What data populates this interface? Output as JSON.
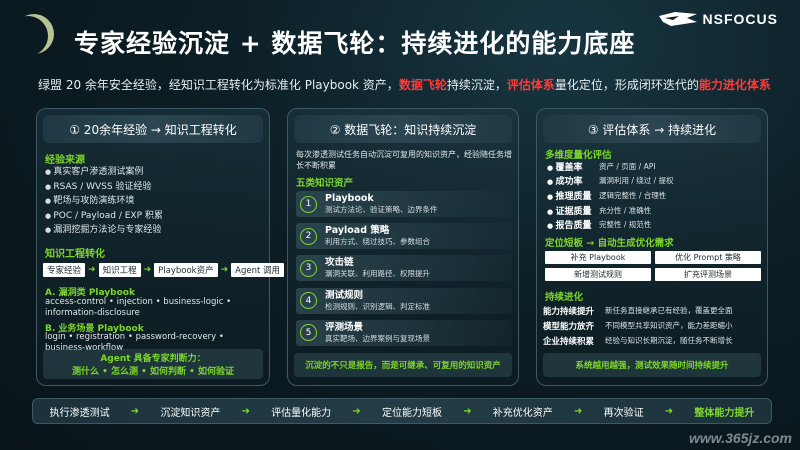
{
  "header": {
    "title": "专家经验沉淀 + 数据飞轮：持续进化的能力底座",
    "logo_text": "NSFOCUS",
    "subtitle_parts": [
      {
        "text": "绿盟 20 余年安全经验，经知识工程转化为标准化 Playbook 资产，",
        "hl": false
      },
      {
        "text": "数据飞轮",
        "hl": true
      },
      {
        "text": "持续沉淀，",
        "hl": false
      },
      {
        "text": "评估体系",
        "hl": true
      },
      {
        "text": "量化定位，形成闭环迭代的",
        "hl": false
      },
      {
        "text": "能力进化体系",
        "hl": true
      }
    ],
    "accent_red": "#ff3a3a",
    "accent_green": "#7cd62a"
  },
  "panel1": {
    "heading": "① 20余年经验 → 知识工程转化",
    "source_title": "经验来源",
    "sources": [
      "真实客户渗透测试案例",
      "RSAS / WVSS 验证经验",
      "靶场与攻防演练环境",
      "POC / Payload / EXP 积累",
      "漏洞挖掘方法论与专家经验"
    ],
    "ke_title": "知识工程转化",
    "tags": [
      "专家经验",
      "知识工程",
      "Playbook资产",
      "Agent 调用"
    ],
    "tag_arrow": "➜",
    "a_title": "A. 漏洞类 Playbook",
    "a_text": "access-control  •  injection  •  business-logic  •  information-disclosure",
    "b_title": "B. 业务场景 Playbook",
    "b_text": "login  •  registration  •  password-recovery  •  business-workflow",
    "agent_line1": "Agent 具备专家判断力：",
    "agent_line2": "测什么 • 怎么测 • 如何判断 • 如何验证"
  },
  "panel2": {
    "heading": "② 数据飞轮：知识持续沉淀",
    "intro": "每次渗透测试任务自动沉淀可复用的知识资产，经验随任务增长不断积累",
    "five_title": "五类知识资产",
    "steps": [
      {
        "num": "1",
        "title": "Playbook",
        "desc": "测试方法论、验证策略、边界条件"
      },
      {
        "num": "2",
        "title": "Payload 策略",
        "desc": "利用方式、绕过技巧、参数组合"
      },
      {
        "num": "3",
        "title": "攻击链",
        "desc": "漏洞关联、利用路径、权限提升"
      },
      {
        "num": "4",
        "title": "测试规则",
        "desc": "检测规则、识别逻辑、判定标准"
      },
      {
        "num": "5",
        "title": "评测场景",
        "desc": "真实靶场、边界案例与复现场景"
      }
    ],
    "footer": "沉淀的不只是报告，而是可继承、可复用的知识资产"
  },
  "panel3": {
    "heading": "③ 评估体系 → 持续进化",
    "multi_title": "多维度量化评估",
    "metrics": [
      {
        "k": "覆盖率",
        "v": "资产 / 页面 / API"
      },
      {
        "k": "成功率",
        "v": "漏洞利用 / 绕过 / 提权"
      },
      {
        "k": "推理质量",
        "v": "逻辑完整性 / 合理性"
      },
      {
        "k": "证据质量",
        "v": "充分性 / 准确性"
      },
      {
        "k": "报告质量",
        "v": "完整性 / 规范性"
      }
    ],
    "gap_title": "定位短板 → 自动生成优化需求",
    "gaps": [
      "补充 Playbook",
      "优化 Prompt 策略",
      "新增测试规则",
      "扩充评测场景"
    ],
    "evo_title": "持续进化",
    "evo": [
      {
        "k": "能力持续提升",
        "v": "新任务直接继承已有经验，覆盖更全面"
      },
      {
        "k": "模型能力放齐",
        "v": "不同模型共享知识资产，能力差距缩小"
      },
      {
        "k": "企业持续积累",
        "v": "经验与知识长期沉淀，随任务不断增长"
      }
    ],
    "footer": "系统越用越强，测试效果随时间持续提升"
  },
  "flow": [
    "执行渗透测试",
    "沉淀知识资产",
    "评估量化能力",
    "定位能力短板",
    "补充优化资产",
    "再次验证",
    "整体能力提升"
  ],
  "flow_arrow": "➜",
  "watermark": "www.365jz.com"
}
